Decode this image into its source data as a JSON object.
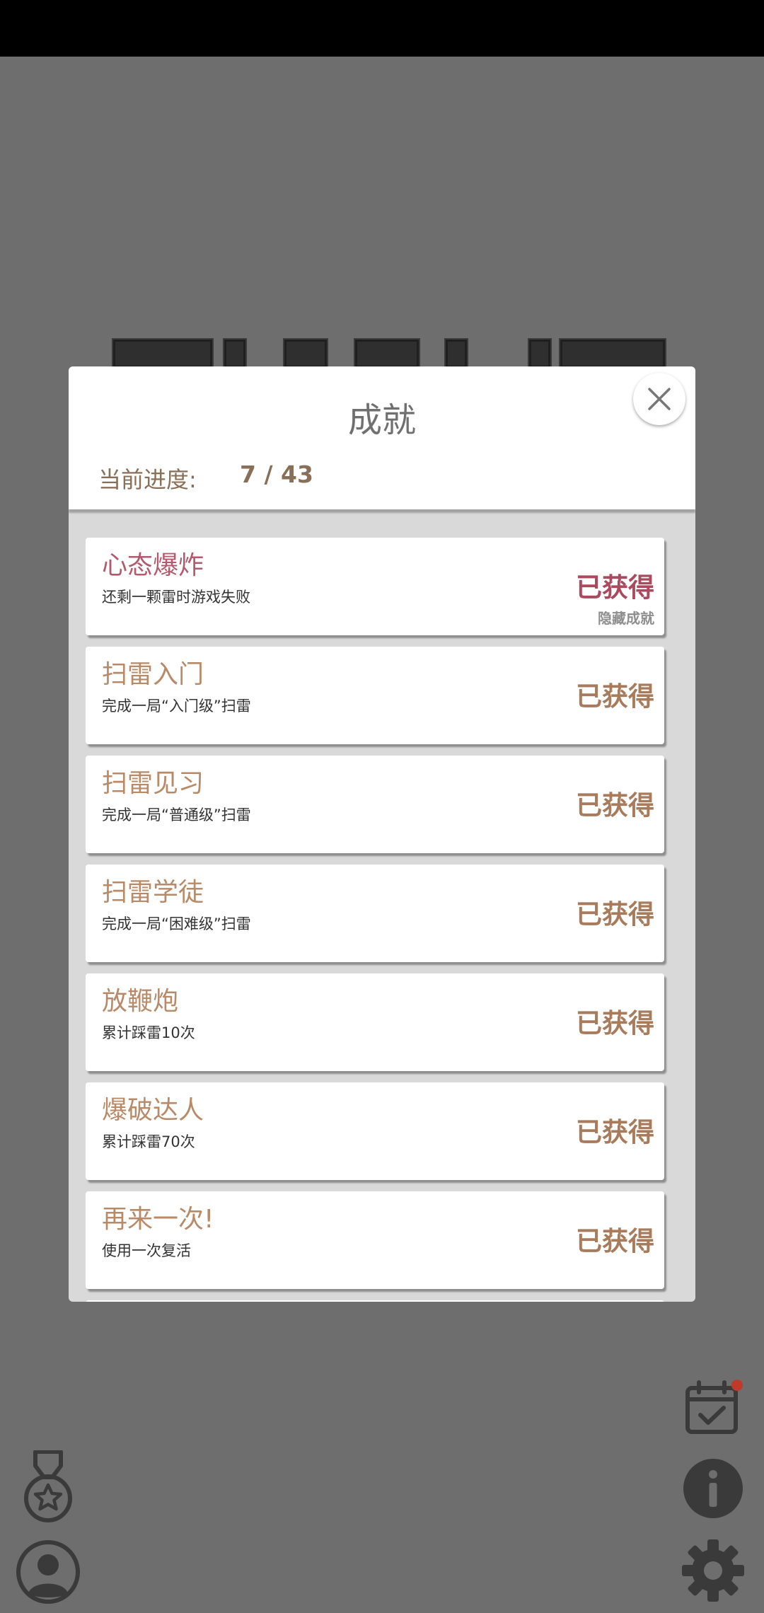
{
  "modal": {
    "title": "成就",
    "progress_label": "当前进度:",
    "progress_value": "7 / 43"
  },
  "achievements": [
    {
      "title": "心态爆炸",
      "desc": "还剩一颗雷时游戏失败",
      "status": "已获得",
      "tag": "隐藏成就"
    },
    {
      "title": "扫雷入门",
      "desc": "完成一局“入门级”扫雷",
      "status": "已获得"
    },
    {
      "title": "扫雷见习",
      "desc": "完成一局“普通级”扫雷",
      "status": "已获得"
    },
    {
      "title": "扫雷学徒",
      "desc": "完成一局“困难级”扫雷",
      "status": "已获得"
    },
    {
      "title": "放鞭炮",
      "desc": "累计踩雷10次",
      "status": "已获得"
    },
    {
      "title": "爆破达人",
      "desc": "累计踩雷70次",
      "status": "已获得"
    },
    {
      "title": "再来一次!",
      "desc": "使用一次复活",
      "status": "已获得"
    }
  ],
  "colors": {
    "accent": "#a77b5b",
    "hidden": "#a94a5e",
    "overlay": "#6e6e6e",
    "notification_dot": "#c0392b"
  },
  "icons": {
    "close": "close-icon",
    "medal": "medal-icon",
    "user": "user-icon",
    "calendar": "calendar-check-icon",
    "info": "info-icon",
    "settings": "gear-icon"
  }
}
